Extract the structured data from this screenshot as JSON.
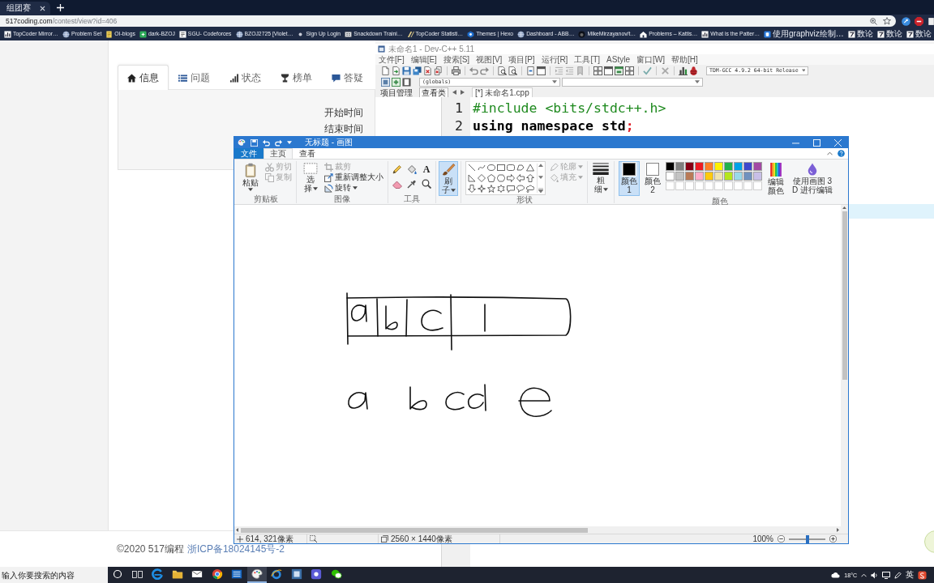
{
  "browser": {
    "tab": {
      "title": "组团赛"
    },
    "address": {
      "host": "517coding.com",
      "path": "/contest/view?id=406"
    },
    "bookmarks": [
      "TopCoder Mirror…",
      "Problem Set",
      "OI-blogs",
      "dark-BZOJ",
      "SGU- Codeforces",
      "BZOJ2725 [Violet…",
      "Sign Up Login",
      "Snackdown Traini…",
      "TopCoder Statisti…",
      "Themes | Hexo",
      "Dashboard - ABB…",
      "MikeMirzayanov/t…",
      "Problems – Kattis…",
      "What is the Patter…",
      "使用graphviz绘制…",
      "数论",
      "数论",
      "数论"
    ]
  },
  "web_page": {
    "tabs": [
      {
        "label": "信息",
        "selected": true
      },
      {
        "label": "问题",
        "selected": false
      },
      {
        "label": "状态",
        "selected": false
      },
      {
        "label": "榜单",
        "selected": false
      },
      {
        "label": "答疑",
        "selected": false
      }
    ],
    "info_labels": [
      "开始时间",
      "结束时间"
    ],
    "footer": {
      "copyright": "©2020 517编程",
      "icp_link": "浙ICP备18024145号-2"
    }
  },
  "devcpp": {
    "title": "未命名1 - Dev-C++ 5.11",
    "menu": [
      "文件[F]",
      "编辑[E]",
      "搜索[S]",
      "视图[V]",
      "项目[P]",
      "运行[R]",
      "工具[T]",
      "AStyle",
      "窗口[W]",
      "帮助[H]"
    ],
    "compiler": "TDM-GCC 4.9.2 64-bit Release",
    "scope": "(globals)",
    "panel_tabs": [
      {
        "label": "项目管理",
        "selected": false
      },
      {
        "label": "查看类",
        "selected": true
      }
    ],
    "file_tab": "[*] 未命名1.cpp",
    "code_lines": [
      {
        "number": "1",
        "tokens": [
          {
            "text": "#include <bits/stdc++.h>",
            "kind": "preprocessor"
          }
        ]
      },
      {
        "number": "2",
        "tokens": [
          {
            "text": "using namespace std",
            "kind": "keyword"
          },
          {
            "text": ";",
            "kind": "symbol"
          }
        ]
      }
    ],
    "current_line_highlight": true
  },
  "paint": {
    "title": "无标题 - 画图",
    "ribbon_tabs": [
      {
        "label": "文件",
        "kind": "menu",
        "selected": false
      },
      {
        "label": "主页",
        "kind": "tab",
        "selected": true
      },
      {
        "label": "查看",
        "kind": "tab",
        "selected": false
      }
    ],
    "clipboard": {
      "label": "剪贴板",
      "paste": "粘贴",
      "cut": {
        "label": "剪切",
        "disabled": true
      },
      "copy": {
        "label": "复制",
        "disabled": true
      }
    },
    "image": {
      "label": "图像",
      "select": "选择",
      "crop": {
        "label": "裁剪",
        "disabled": true
      },
      "resize": {
        "label": "重新调整大小",
        "disabled": false
      },
      "rotate": {
        "label": "旋转",
        "disabled": false
      }
    },
    "tools": {
      "label": "工具",
      "items": [
        {
          "kind": "pencil",
          "selected": false
        },
        {
          "kind": "fill",
          "selected": false
        },
        {
          "kind": "text",
          "glyph": "A",
          "selected": false
        },
        {
          "kind": "eraser",
          "selected": false
        },
        {
          "kind": "picker",
          "selected": false
        },
        {
          "kind": "magnifier",
          "selected": false
        }
      ]
    },
    "brushes": {
      "label": "刷子",
      "selected": true
    },
    "shapes": {
      "label": "形状",
      "outline": {
        "label": "轮廓",
        "disabled": true
      },
      "fill": {
        "label": "填充",
        "disabled": true
      }
    },
    "size": {
      "label": "粗细"
    },
    "colors": {
      "label": "颜色",
      "color1": {
        "label": "颜色 1",
        "color": "#000000",
        "selected": true
      },
      "color2": {
        "label": "颜色 2",
        "color": "#ffffff",
        "selected": false
      },
      "palette": [
        {
          "color": "#000000"
        },
        {
          "color": "#7f7f7f"
        },
        {
          "color": "#880015"
        },
        {
          "color": "#ed1c24"
        },
        {
          "color": "#ff7f27"
        },
        {
          "color": "#fff200"
        },
        {
          "color": "#22b14c"
        },
        {
          "color": "#00a2e8"
        },
        {
          "color": "#3f48cc"
        },
        {
          "color": "#a349a4"
        },
        {
          "color": "#ffffff"
        },
        {
          "color": "#c3c3c3"
        },
        {
          "color": "#b97a57"
        },
        {
          "color": "#ffaec9"
        },
        {
          "color": "#ffc90e"
        },
        {
          "color": "#efe4b0"
        },
        {
          "color": "#b5e61d"
        },
        {
          "color": "#99d9ea"
        },
        {
          "color": "#7092be"
        },
        {
          "color": "#c8bfe7"
        }
      ],
      "edit_colors": "编辑颜色",
      "paint3d": "使用画图 3D 进行编辑"
    },
    "status": {
      "cursor": "614, 321像素",
      "canvas_size": "2560 × 1440像素",
      "zoom": {
        "label": "100%",
        "level": 0.5
      }
    }
  },
  "taskbar": {
    "search": {
      "placeholder": "输入你要搜索的内容"
    },
    "apps": [
      {
        "selected": false
      },
      {
        "selected": false
      },
      {
        "selected": false
      },
      {
        "selected": false
      },
      {
        "selected": false
      },
      {
        "selected": true
      },
      {
        "selected": false
      },
      {
        "selected": false
      },
      {
        "selected": false
      },
      {
        "selected": false
      }
    ],
    "weather": "18°C",
    "input_method": "英"
  }
}
